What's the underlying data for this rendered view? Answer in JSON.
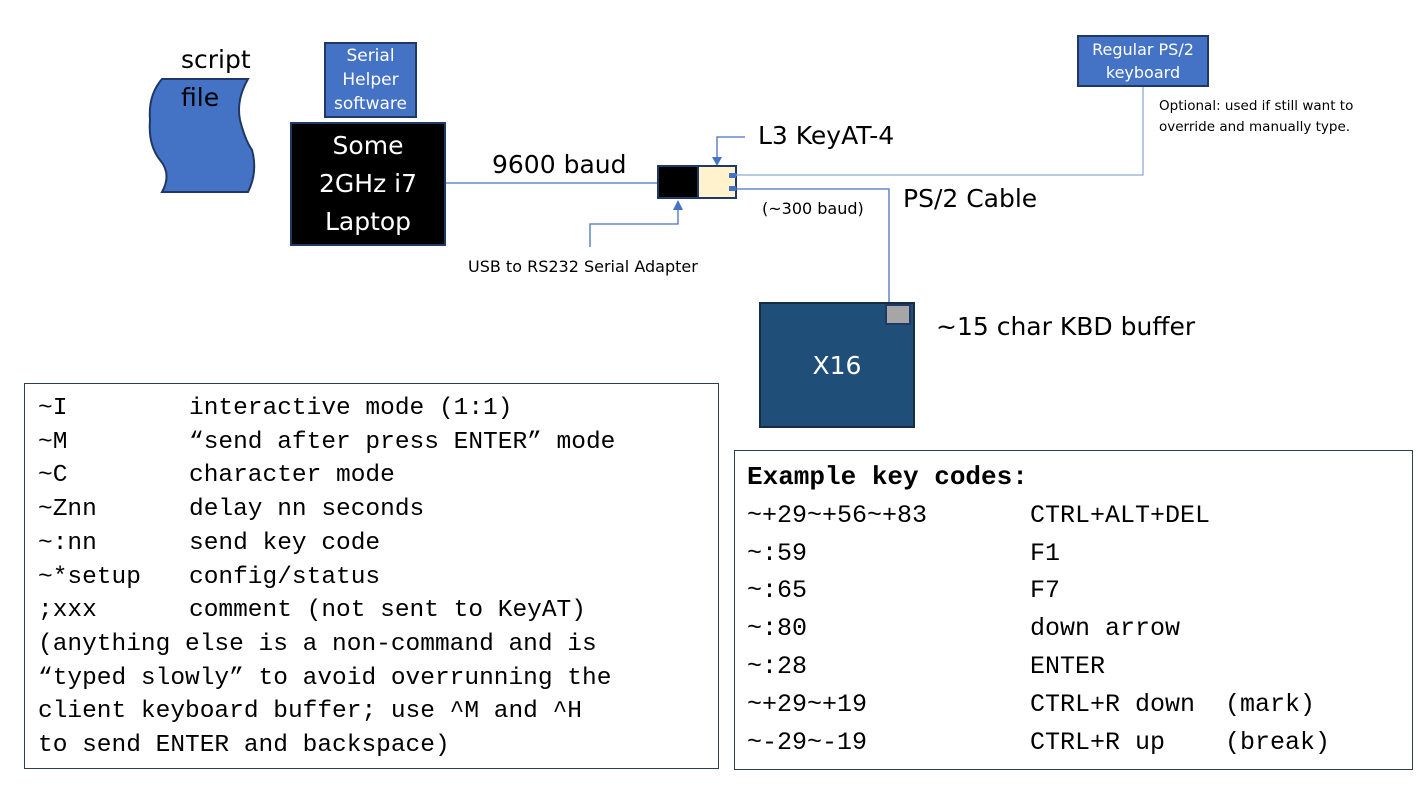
{
  "diagram": {
    "script_file": {
      "line1": "script",
      "line2": "file"
    },
    "helper_software": {
      "line1": "Serial",
      "line2": "Helper",
      "line3": "software"
    },
    "laptop": {
      "line1": "Some",
      "line2": "2GHz i7",
      "line3": "Laptop"
    },
    "baud_9600": "9600 baud",
    "keyat_label": "L3 KeyAT-4",
    "usb_adapter": "USB to RS232 Serial Adapter",
    "baud_300": "(~300 baud)",
    "ps2_cable": "PS/2 Cable",
    "ps2_keyboard": {
      "line1": "Regular PS/2",
      "line2": "keyboard"
    },
    "optional_note": {
      "line1": "Optional: used if still want to",
      "line2": "override and manually type."
    },
    "x16": "X16",
    "kbd_buffer": "~15 char KBD buffer",
    "colors": {
      "accent_blue": "#4472c4",
      "x16_blue": "#1f4e79",
      "keyat_cream": "#fff2cc",
      "wire": "#4472c4"
    }
  },
  "commands": {
    "rows": [
      {
        "cmd": "~I",
        "desc": "interactive mode (1:1)"
      },
      {
        "cmd": "~M",
        "desc": "“send after press ENTER” mode"
      },
      {
        "cmd": "~C",
        "desc": "character mode"
      },
      {
        "cmd": "~Znn",
        "desc": "delay nn seconds"
      },
      {
        "cmd": "~:nn",
        "desc": "send key code"
      },
      {
        "cmd": "~*setup",
        "desc": "config/status"
      },
      {
        "cmd": ";xxx",
        "desc": "comment (not sent to KeyAT)"
      }
    ],
    "note": [
      "(anything else is a non-command and is",
      "“typed slowly” to avoid overrunning the",
      "client keyboard buffer; use ^M and ^H",
      "to send ENTER and backspace)"
    ]
  },
  "keycodes": {
    "title": "Example key codes:",
    "rows": [
      {
        "code": "~+29~+56~+83",
        "desc": "CTRL+ALT+DEL"
      },
      {
        "code": "~:59",
        "desc": "F1"
      },
      {
        "code": "~:65",
        "desc": "F7"
      },
      {
        "code": "~:80",
        "desc": "down arrow"
      },
      {
        "code": "~:28",
        "desc": "ENTER"
      },
      {
        "code": "~+29~+19",
        "desc": "CTRL+R down  (mark)"
      },
      {
        "code": "~-29~-19",
        "desc": "CTRL+R up    (break)"
      }
    ]
  }
}
